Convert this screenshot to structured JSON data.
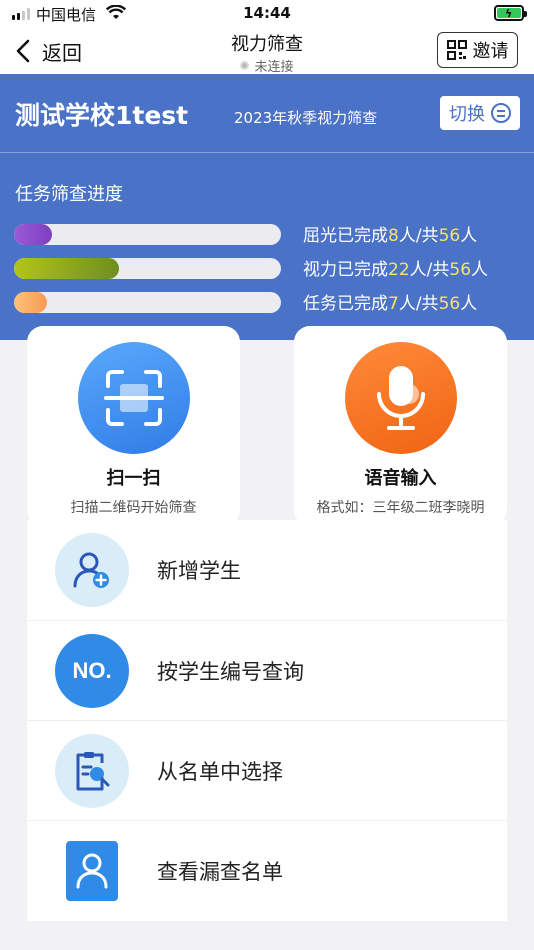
{
  "status_bar": {
    "carrier": "中国电信",
    "time": "14:44"
  },
  "nav": {
    "back_label": "返回",
    "title": "视力筛查",
    "connection_status": "未连接",
    "invite_label": "邀请"
  },
  "header": {
    "school_name": "测试学校1test",
    "campaign": "2023年秋季视力筛查",
    "switch_label": "切换"
  },
  "progress": {
    "title": "任务筛查进度",
    "rows": [
      {
        "prefix": "屈光已完成",
        "done": "8",
        "mid": "人/共",
        "total": "56",
        "suffix": "人",
        "fraction": 0.143,
        "color_start": "#9b5bd6",
        "color_end": "#7d3fc0"
      },
      {
        "prefix": "视力已完成",
        "done": "22",
        "mid": "人/共",
        "total": "56",
        "suffix": "人",
        "fraction": 0.393,
        "color_start": "#b3c41a",
        "color_end": "#6e8f1e"
      },
      {
        "prefix": "任务已完成",
        "done": "7",
        "mid": "人/共",
        "total": "56",
        "suffix": "人",
        "fraction": 0.125,
        "color_start": "#ffc27a",
        "color_end": "#f79a52"
      }
    ]
  },
  "cards": {
    "scan": {
      "title": "扫一扫",
      "desc": "扫描二维码开始筛查",
      "color": "#3a8ff0"
    },
    "voice": {
      "title": "语音输入",
      "desc": "格式如：三年级二班李晓明",
      "color": "#f5731c"
    }
  },
  "menu": {
    "items": [
      {
        "label": "新增学生"
      },
      {
        "label": "按学生编号查询",
        "badge": "NO."
      },
      {
        "label": "从名单中选择"
      },
      {
        "label": "查看漏查名单"
      }
    ]
  },
  "colors": {
    "primary_blue": "#4a72c6",
    "highlight_yellow": "#f7e26b",
    "icon_bg_light": "#d9edf8",
    "icon_blue": "#2f8be6"
  }
}
